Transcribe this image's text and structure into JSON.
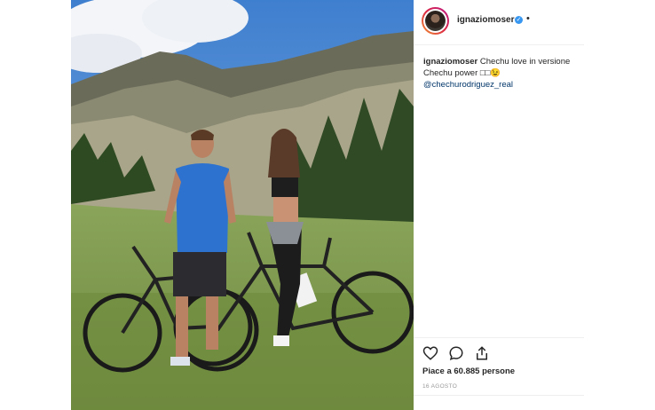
{
  "post": {
    "username": "ignaziomoser",
    "more_dot": "•",
    "verified_mark": "✓",
    "caption_user": "ignaziomoser",
    "caption_text": "Chechu love in versione Chechu power",
    "caption_emoji": "□□😉",
    "mention": "@chechurodriguez_real",
    "likes": "Piace a 60.885 persone",
    "date": "16 AGOSTO"
  },
  "icons": {
    "like": "heart-icon",
    "comment": "comment-icon",
    "share": "share-icon",
    "verified": "verified-badge-icon"
  },
  "colors": {
    "verified": "#3897f0",
    "mention": "#003569",
    "text": "#262626",
    "muted": "#999999",
    "divider": "#efefef"
  }
}
